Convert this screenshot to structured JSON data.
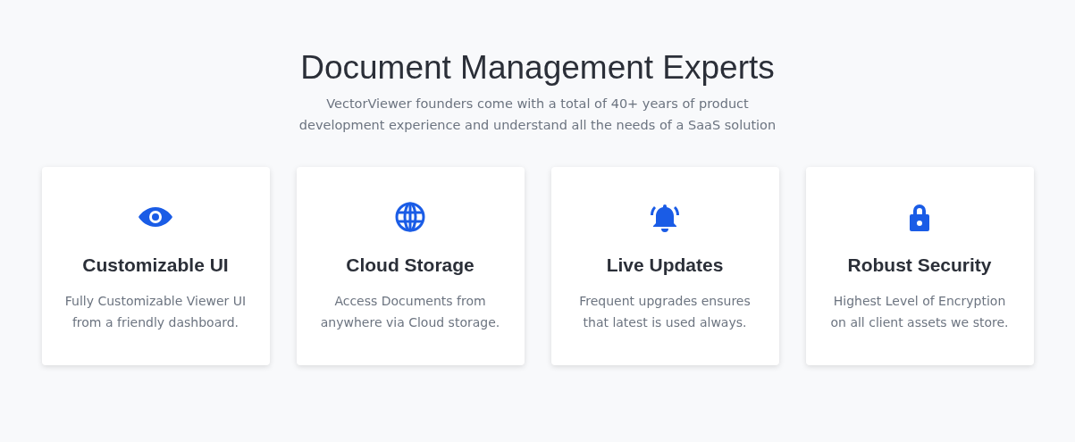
{
  "heading": "Document Management Experts",
  "subtitle": "VectorViewer founders come with a total of 40+ years of product development experience and understand all the needs of a SaaS solution",
  "features": [
    {
      "kind": "eye",
      "title": "Customizable UI",
      "text": "Fully Customizable Viewer UI from a friendly dashboard."
    },
    {
      "kind": "globe",
      "title": "Cloud Storage",
      "text": "Access Documents from anywhere via Cloud storage."
    },
    {
      "kind": "bell",
      "title": "Live Updates",
      "text": "Frequent upgrades ensures that latest is used always."
    },
    {
      "kind": "lock",
      "title": "Robust Security",
      "text": "Highest Level of Encryption on all client assets we store."
    }
  ]
}
